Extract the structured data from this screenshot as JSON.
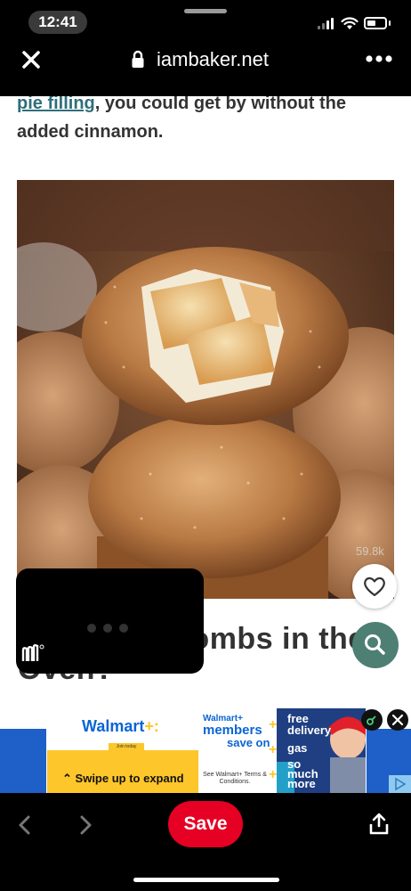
{
  "status_bar": {
    "time": "12:41",
    "battery_level": 0.45
  },
  "url_bar": {
    "domain": "iambaker.net",
    "close_icon": "close-icon",
    "lock_icon": "lock-icon",
    "more_icon": "more-options-icon"
  },
  "article": {
    "link_text": "pie filling",
    "text_after_link": ", you could get by without the added cinnamon.",
    "view_count": "59.8k",
    "heading_visible": "Apple Pie Bombs in the Oven?"
  },
  "ad": {
    "brand": "Walmart",
    "spark": "+:",
    "small_tag": "Join today",
    "swipe_text": "Swipe up to expand",
    "members_line1": "Walmart+",
    "members_line2": "members",
    "members_line3": "save on",
    "terms": "See Walmart+ Terms & Conditions.",
    "features": [
      "free delivery",
      "gas",
      "so much more"
    ]
  },
  "toolbar": {
    "save_label": "Save"
  },
  "colors": {
    "save_red": "#e60023",
    "link_teal": "#2f6f7a",
    "walmart_blue": "#0a65d5",
    "walmart_yellow": "#fdc62a",
    "search_teal": "#4e7f73"
  }
}
